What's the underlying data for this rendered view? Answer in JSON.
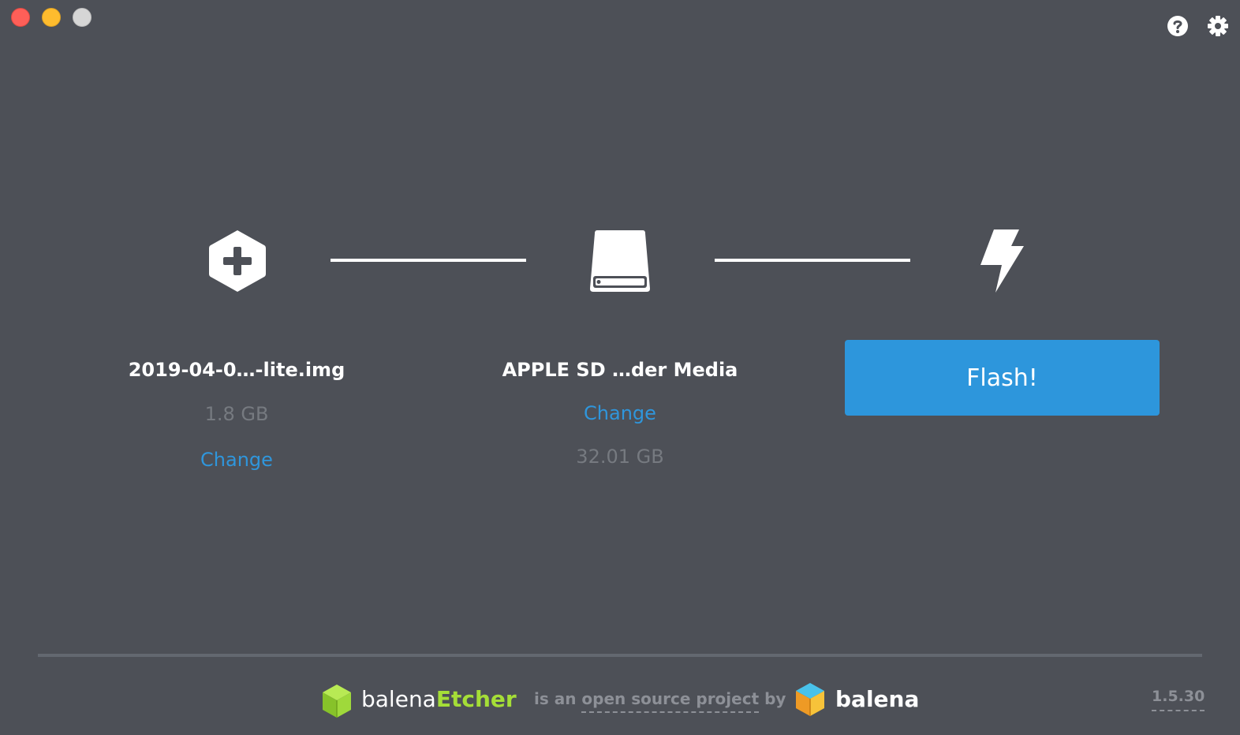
{
  "window": {
    "controls": [
      "close",
      "minimize",
      "zoom"
    ],
    "help_icon": "question-circle-icon",
    "settings_icon": "gear-icon"
  },
  "steps": {
    "image": {
      "icon": "hexagon-plus-icon",
      "name": "2019-04-0…-lite.img",
      "size": "1.8 GB",
      "change_label": "Change"
    },
    "drive": {
      "icon": "drive-icon",
      "name": "APPLE SD …der Media",
      "change_label": "Change",
      "size": "32.01 GB"
    },
    "flash": {
      "icon": "lightning-icon",
      "button_label": "Flash!"
    }
  },
  "footer": {
    "brand_part1": "balena",
    "brand_part2": "Etcher",
    "tagline_prefix": "is an ",
    "tagline_link": "open source project",
    "tagline_suffix": " by",
    "company": "balena",
    "version": "1.5.30"
  },
  "colors": {
    "background": "#4d5057",
    "accent": "#2d96dc",
    "etcher_green": "#a5de37",
    "muted_text": "#767a80"
  }
}
